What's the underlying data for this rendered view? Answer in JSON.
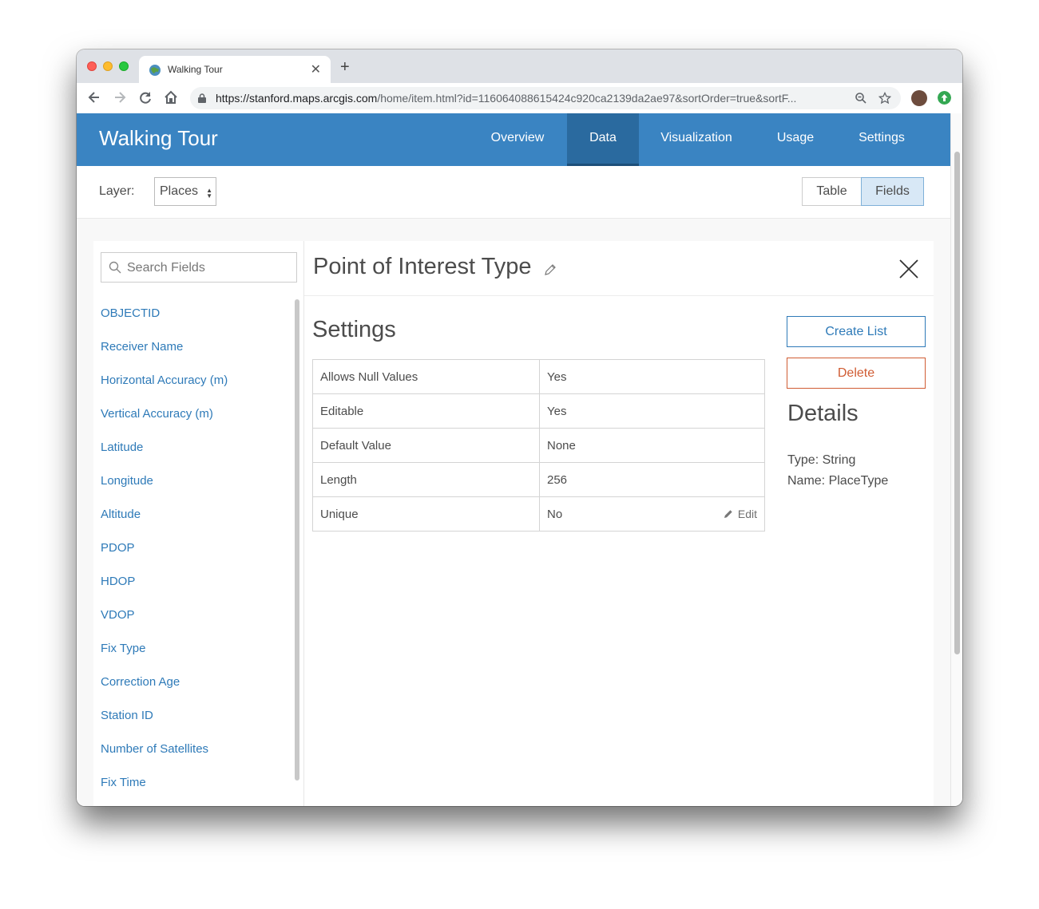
{
  "browser": {
    "tab_title": "Walking Tour",
    "url_host": "https://stanford.maps.arcgis.com",
    "url_path": "/home/item.html?id=116064088615424c920ca2139da2ae97&sortOrder=true&sortF..."
  },
  "header": {
    "title": "Walking Tour",
    "tabs": [
      {
        "label": "Overview"
      },
      {
        "label": "Data"
      },
      {
        "label": "Visualization"
      },
      {
        "label": "Usage"
      },
      {
        "label": "Settings"
      }
    ],
    "active_tab": "Data"
  },
  "layerbar": {
    "label": "Layer:",
    "selected": "Places",
    "view_toggle": [
      "Table",
      "Fields"
    ],
    "active_view": "Fields"
  },
  "fields_panel": {
    "search_placeholder": "Search Fields",
    "items": [
      "OBJECTID",
      "Receiver Name",
      "Horizontal Accuracy (m)",
      "Vertical Accuracy (m)",
      "Latitude",
      "Longitude",
      "Altitude",
      "PDOP",
      "HDOP",
      "VDOP",
      "Fix Type",
      "Correction Age",
      "Station ID",
      "Number of Satellites",
      "Fix Time"
    ]
  },
  "detail": {
    "title": "Point of Interest Type",
    "settings_title": "Settings",
    "settings": [
      {
        "key": "Allows Null Values",
        "value": "Yes"
      },
      {
        "key": "Editable",
        "value": "Yes"
      },
      {
        "key": "Default Value",
        "value": "None"
      },
      {
        "key": "Length",
        "value": "256"
      },
      {
        "key": "Unique",
        "value": "No"
      }
    ],
    "edit_label": "Edit",
    "create_list_label": "Create List",
    "delete_label": "Delete",
    "details_title": "Details",
    "type_line": "Type: String",
    "name_line": "Name: PlaceType"
  },
  "colors": {
    "header_bg": "#3a84c2",
    "active_tab_bg": "#2a6a9f",
    "link": "#2e7ab8",
    "danger": "#d05c33"
  }
}
